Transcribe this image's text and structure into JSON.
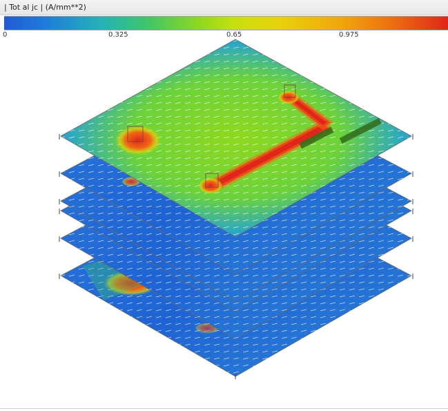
{
  "legend": {
    "title": "| Tot al jc | (A/mm**2)",
    "ticks": [
      "0",
      "0.325",
      "0.65",
      "0.975"
    ],
    "colors": {
      "low": "#1f5bd6",
      "mid_low": "#3dc66a",
      "mid": "#c6e00f",
      "mid_high": "#f0a60c",
      "high": "#e0261a"
    }
  },
  "viewport": {
    "plate_count": 6,
    "colors": {
      "top_plate_field": "#8fd81f",
      "bottom_plates_field": "#1f6fd8",
      "hot_trace": "#e0261a",
      "outline": "#666666",
      "vector_arrows": "#ffffff",
      "text_overlay": "#2f6b1a"
    }
  }
}
